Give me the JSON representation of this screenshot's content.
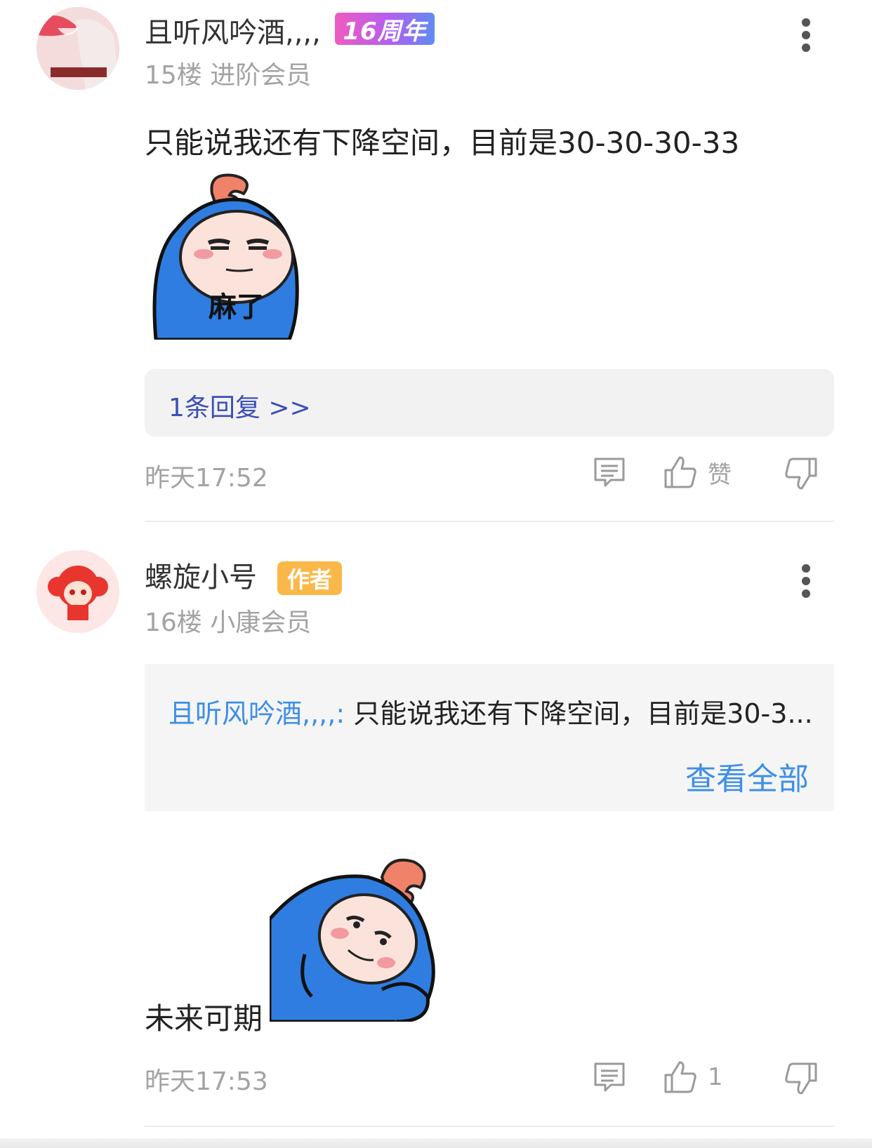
{
  "posts": [
    {
      "username": "且听风吟酒,,,,",
      "badge": "16周年",
      "floor": "15楼",
      "member_level": "进阶会员",
      "content": "只能说我还有下降空间，目前是30-30-30-33",
      "sticker_text": "麻了",
      "reply_link": "1条回复 >>",
      "time": "昨天17:52",
      "like_label": "赞"
    },
    {
      "username": "螺旋小号",
      "badge": "作者",
      "floor": "16楼",
      "member_level": "小康会员",
      "quote_user": "且听风吟酒,,,,:",
      "quote_text": " 只能说我还有下降空间，目前是30-3...",
      "view_all": "查看全部",
      "content": "未来可期",
      "time": "昨天17:53",
      "like_label": "1"
    }
  ],
  "colors": {
    "link_blue": "#3d8ee8",
    "reply_blue": "#3b4fb8",
    "gray_text": "#a3a3a3",
    "author_badge": "#fbb84a",
    "sticker_blue": "#2f7de0"
  },
  "icons": [
    "more-vertical-icon",
    "comment-icon",
    "thumbs-up-icon",
    "thumbs-down-icon"
  ]
}
